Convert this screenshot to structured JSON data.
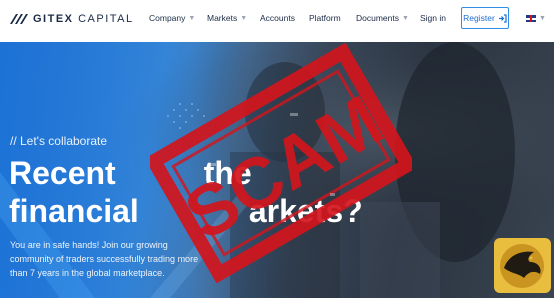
{
  "brand": {
    "logo_text_bold": "GITEX",
    "logo_text_rest": " CAPITAL"
  },
  "nav": {
    "items": [
      {
        "label": "Company",
        "has_caret": true
      },
      {
        "label": "Markets",
        "has_caret": true
      },
      {
        "label": "Accounts",
        "has_caret": false
      },
      {
        "label": "Platform",
        "has_caret": false
      },
      {
        "label": "Documents",
        "has_caret": true
      },
      {
        "label": "Sign in",
        "has_caret": false
      }
    ],
    "register_label": "Register",
    "language_flag": "uk-flag-icon"
  },
  "hero": {
    "kicker": "// Let's collaborate",
    "headline_line1": "Recent",
    "headline_line1_tail": "the",
    "headline_line2": "financial",
    "headline_line2_tail": "arkets?",
    "description": "You are in safe hands! Join our growing community of traders successfully trading more than 7 years in the global marketplace."
  },
  "overlay": {
    "stamp_text": "SCAM",
    "stamp_color": "#d3151c"
  },
  "colors": {
    "brand_dark": "#1b2b47",
    "accent_blue": "#2f8ee6",
    "stamp_red": "#d3151c",
    "eagle_gold": "#e9bd3d"
  }
}
